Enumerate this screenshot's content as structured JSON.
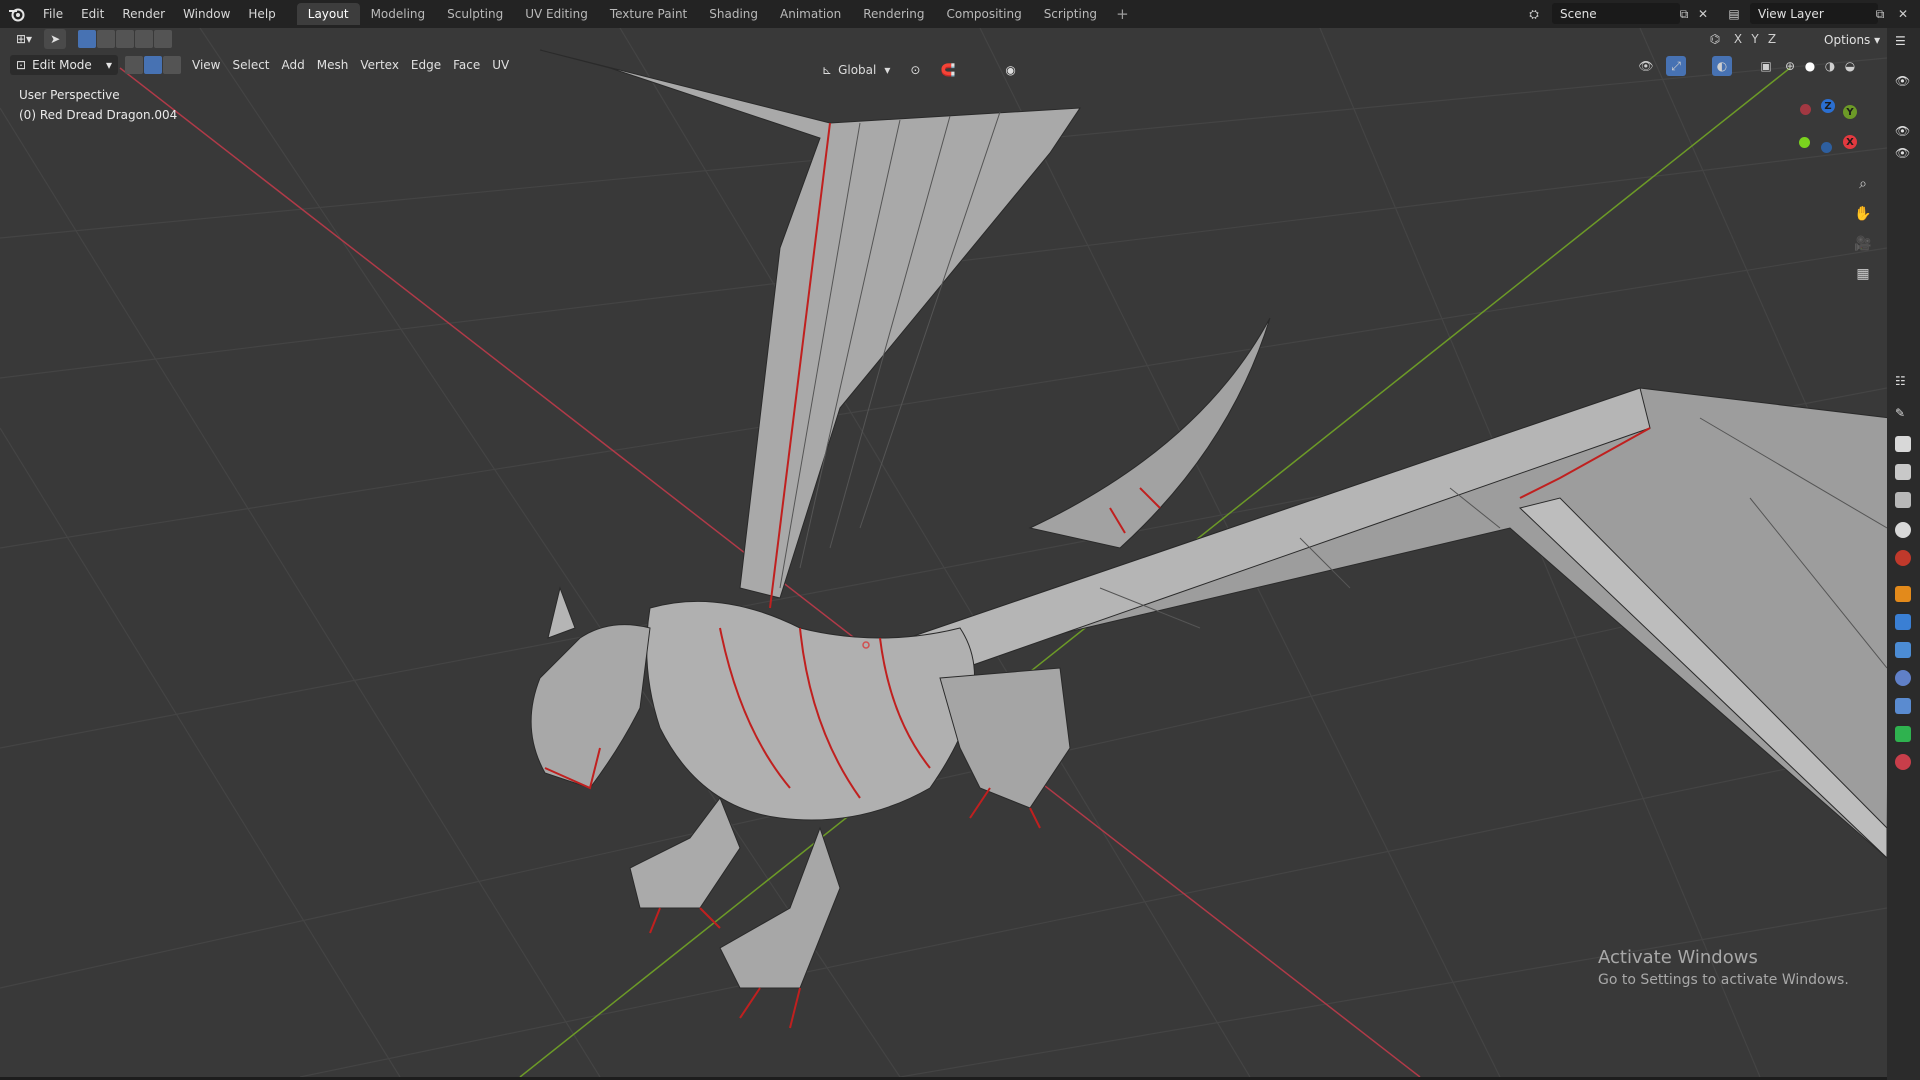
{
  "topbar": {
    "menus": [
      "File",
      "Edit",
      "Render",
      "Window",
      "Help"
    ],
    "workspaces": [
      "Layout",
      "Modeling",
      "Sculpting",
      "UV Editing",
      "Texture Paint",
      "Shading",
      "Animation",
      "Rendering",
      "Compositing",
      "Scripting"
    ],
    "active_workspace": "Layout",
    "scene_label": "Scene",
    "view_layer_label": "View Layer"
  },
  "header": {
    "mode": "Edit Mode",
    "menus": [
      "View",
      "Select",
      "Add",
      "Mesh",
      "Vertex",
      "Edge",
      "Face",
      "UV"
    ],
    "orientation": "Global",
    "options_label": "Options"
  },
  "viewport": {
    "perspective_label": "User Perspective",
    "object_label": "(0) Red Dread Dragon.004",
    "gizmo_axes": [
      "Z",
      "Y",
      "X"
    ],
    "colors": {
      "background": "#393939",
      "grid": "#444444",
      "x_axis": "#b03a48",
      "y_axis": "#6c9a27",
      "seam": "#d02020",
      "mesh": "#9a9a9a"
    }
  },
  "watermark": {
    "title": "Activate Windows",
    "subtitle": "Go to Settings to activate Windows."
  }
}
